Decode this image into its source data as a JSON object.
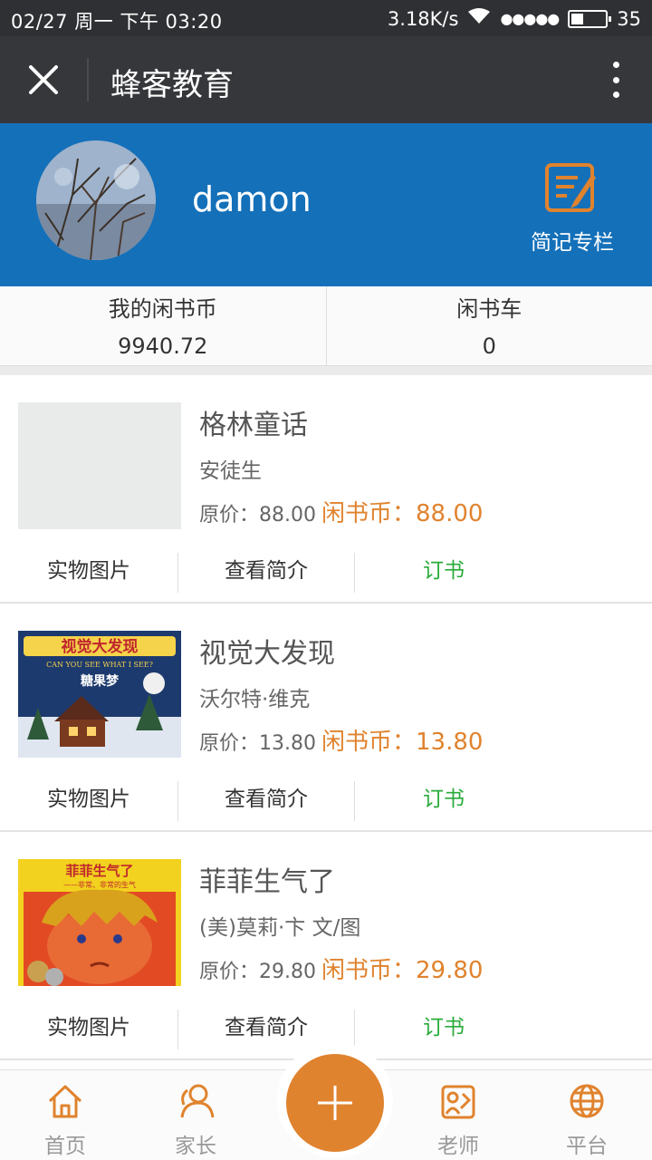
{
  "status": {
    "datetime": "02/27  周一  下午 03:20",
    "speed": "3.18K/s",
    "signal": "●●●●●",
    "battery": "35",
    "battery_fraction": 0.35
  },
  "titlebar": {
    "title": "蜂客教育",
    "close_icon": "close-icon",
    "more_icon": "more-vertical-icon"
  },
  "profile": {
    "username": "damon",
    "notes_label": "简记专栏",
    "accent": "#1470b9"
  },
  "wallet": {
    "coins_label": "我的闲书币",
    "coins_value": "9940.72",
    "cart_label": "闲书车",
    "cart_value": "0"
  },
  "books": [
    {
      "title": "格林童话",
      "author": "安徒生",
      "price_label": "原价：",
      "price": "88.00",
      "coin_label": "闲书币：",
      "coin_price": "88.00",
      "photo_label": "实物图片",
      "intro_label": "查看简介",
      "order_label": "订书"
    },
    {
      "title": "视觉大发现",
      "author": "沃尔特·维克",
      "price_label": "原价：",
      "price": "13.80",
      "coin_label": "闲书币：",
      "coin_price": "13.80",
      "photo_label": "实物图片",
      "intro_label": "查看简介",
      "order_label": "订书",
      "cover_text": "视觉大发现",
      "cover_sub": "CAN YOU SEE WHAT I SEE?",
      "cover_sub2": "糖果梦"
    },
    {
      "title": "菲菲生气了",
      "author": "(美)莫莉·卞 文/图",
      "price_label": "原价：",
      "price": "29.80",
      "coin_label": "闲书币：",
      "coin_price": "29.80",
      "photo_label": "实物图片",
      "intro_label": "查看简介",
      "order_label": "订书",
      "cover_text": "菲菲生气了",
      "cover_sub": "——非常、非常的生气"
    }
  ],
  "tabbar": {
    "home": "首页",
    "parent": "家长",
    "teacher": "老师",
    "platform": "平台",
    "accent": "#e0832e"
  }
}
